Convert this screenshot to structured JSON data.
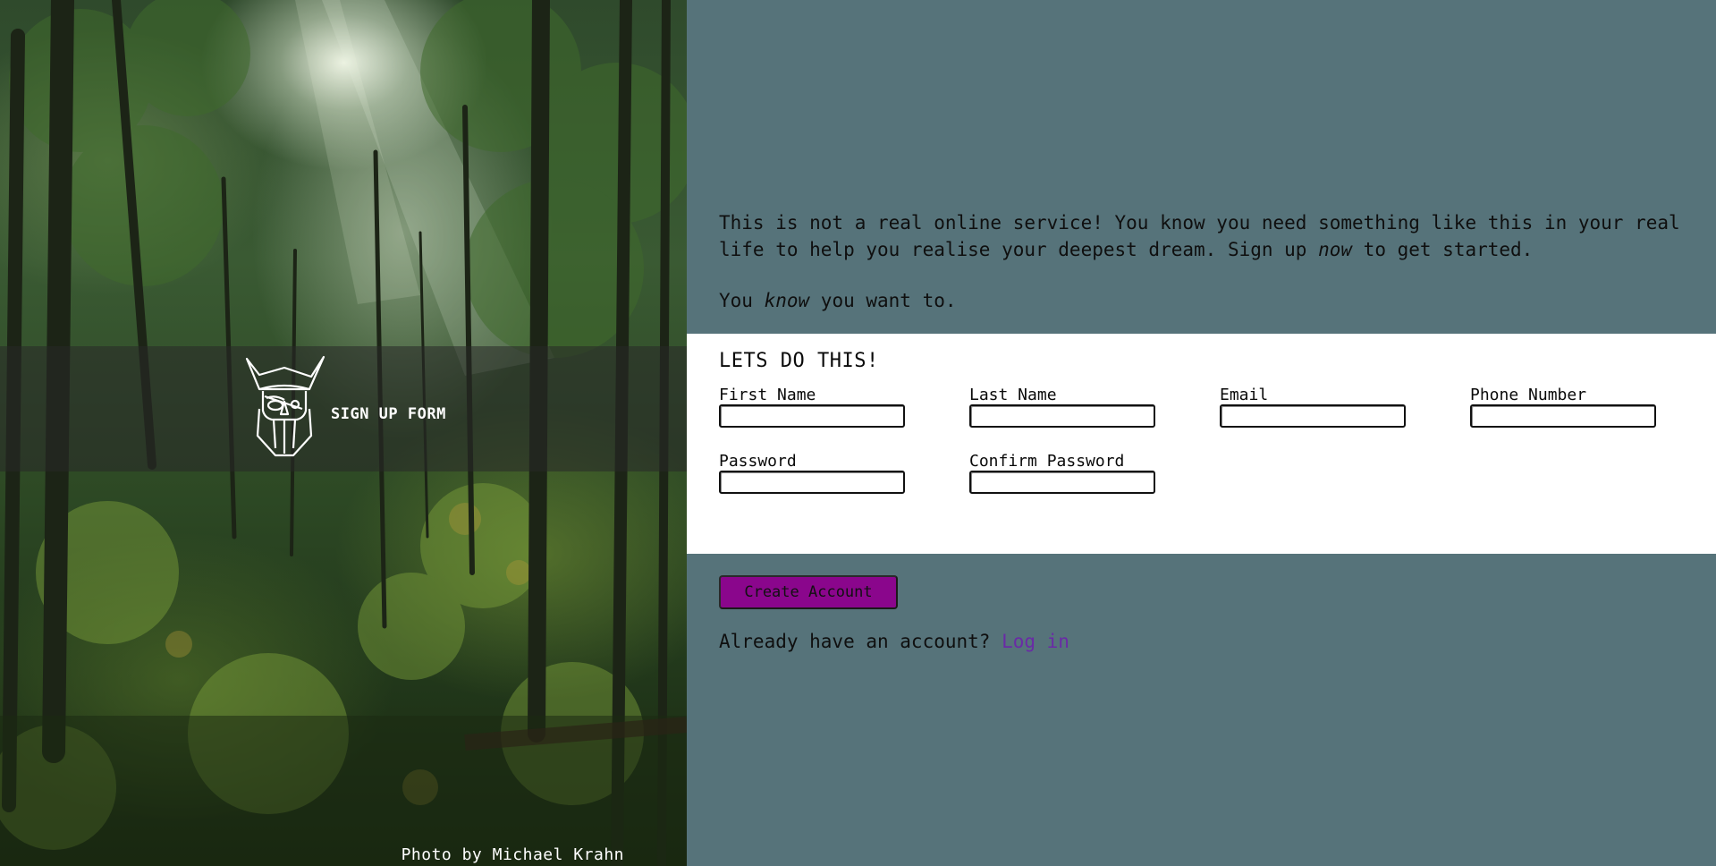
{
  "brand": {
    "title": "SIGN UP FORM",
    "logo_icon": "odin-viking-helmet-icon"
  },
  "photo_credit": {
    "prefix": "Photo by ",
    "author": "Michael Krahn"
  },
  "intro": {
    "p1_before": "This is not a real online service! You know you need something like this in your real life to help you realise your deepest dream. Sign up ",
    "p1_em": "now",
    "p1_after": " to get started.",
    "p2_before": "You ",
    "p2_em": "know",
    "p2_after": " you want to."
  },
  "form": {
    "heading": "LETS DO THIS!",
    "fields": [
      {
        "label": "First Name",
        "value": ""
      },
      {
        "label": "Last Name",
        "value": ""
      },
      {
        "label": "Email",
        "value": ""
      },
      {
        "label": "Phone Number",
        "value": ""
      },
      {
        "label": "Password",
        "value": ""
      },
      {
        "label": "Confirm Password",
        "value": ""
      }
    ]
  },
  "actions": {
    "create_label": "Create Account",
    "login_prompt": "Already have an account? ",
    "login_link": "Log in"
  },
  "colors": {
    "page_background": "#56737a",
    "form_background": "#ffffff",
    "button_background": "#8a068c",
    "link": "#6a2aa6"
  }
}
